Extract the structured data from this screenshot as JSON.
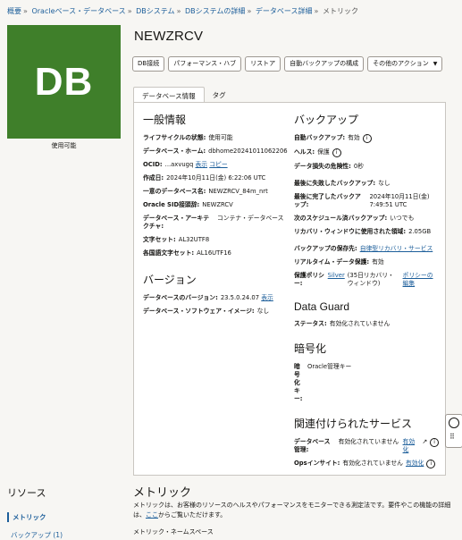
{
  "breadcrumb": [
    "概要",
    "Oracleベース・データベース",
    "DBシステム",
    "DBシステムの詳細",
    "データベース詳細",
    "メトリック"
  ],
  "db_tile": {
    "text": "DB",
    "status": "使用可能",
    "color": "#3f7f2a"
  },
  "title": "NEWZRCV",
  "actions": {
    "db_connect": "DB接続",
    "performance_hub": "パフォーマンス・ハブ",
    "restore": "リストア",
    "auto_backup": "自動バックアップの構成",
    "more_actions": "その他のアクション"
  },
  "tabs": {
    "db_info": "データベース情報",
    "tags": "タグ"
  },
  "general": {
    "title": "一般情報",
    "lifecycle_k": "ライフサイクルの状態:",
    "lifecycle_v": "使用可能",
    "home_k": "データベース・ホーム:",
    "home_v": "dbhome20241011062206",
    "ocid_k": "OCID:",
    "ocid_v": "...axvugq",
    "ocid_show": "表示",
    "ocid_copy": "コピー",
    "created_k": "作成日:",
    "created_v": "2024年10月11日(金) 6:22:06 UTC",
    "unique_k": "一意のデータベース名:",
    "unique_v": "NEWZRCV_84m_nrt",
    "sid_k": "Oracle SID接頭辞:",
    "sid_v": "NEWZRCV",
    "arch_k": "データベース・アーキテクチャ:",
    "arch_v": "コンテナ・データベース",
    "charset_k": "文字セット:",
    "charset_v": "AL32UTF8",
    "ncharset_k": "各国語文字セット:",
    "ncharset_v": "AL16UTF16"
  },
  "version": {
    "title": "バージョン",
    "db_ver_k": "データベースのバージョン:",
    "db_ver_v": "23.5.0.24.07",
    "db_ver_show": "表示",
    "sw_image_k": "データベース・ソフトウェア・イメージ:",
    "sw_image_v": "なし"
  },
  "backup": {
    "title": "バックアップ",
    "auto_k": "自動バックアップ:",
    "auto_v": "有効",
    "health_k": "ヘルス:",
    "health_v": "保護",
    "risk_k": "データ損失の危険性:",
    "risk_v": "0秒",
    "last_fail_k": "最後に失敗したバックアップ:",
    "last_fail_v": "なし",
    "last_done_k": "最後に完了したバックアップ:",
    "last_done_v": "2024年10月11日(金) 7:49:51 UTC",
    "next_k": "次のスケジュール済バックアップ:",
    "next_v": "いつでも",
    "recovery_k": "リカバリ・ウィンドウに使用された領域:",
    "recovery_v": "2.05GB",
    "dest_k": "バックアップの保存先:",
    "dest_v": "自律型リカバリ・サービス",
    "realtime_k": "リアルタイム・データ保護:",
    "realtime_v": "有効",
    "policy_k": "保護ポリシー:",
    "policy_name": "Silver",
    "policy_desc": "(35日リカバリ・ウィンドウ)",
    "policy_edit": "ポリシーの編集"
  },
  "dataguard": {
    "title": "Data Guard",
    "status_k": "ステータス:",
    "status_v": "有効化されていません"
  },
  "encryption": {
    "title": "暗号化",
    "key_k": "暗号化キー:",
    "key_v": "Oracle管理キー"
  },
  "services": {
    "title": "関連付けられたサービス",
    "dbmgmt_k": "データベース管理:",
    "dbmgmt_v": "有効化されていません",
    "dbmgmt_link": "有効化",
    "ops_k": "Opsインサイト:",
    "ops_v": "有効化されていません",
    "ops_link": "有効化"
  },
  "resources": {
    "title": "リソース",
    "metrics": "メトリック",
    "backups": "バックアップ (1)"
  },
  "metrics": {
    "title": "メトリック",
    "desc_1": "メトリックは、お客様のリソースのヘルスやパフォーマンスをモニターできる測定法です。要件やこの機能の詳細は、",
    "desc_link": "ここ",
    "desc_2": "からご覧いただけます。",
    "namespace": "メトリック・ネームスペース"
  },
  "colors": {
    "accent": "#1c5e9a",
    "db_green": "#3f7f2a",
    "background": "#f7f6f3"
  }
}
